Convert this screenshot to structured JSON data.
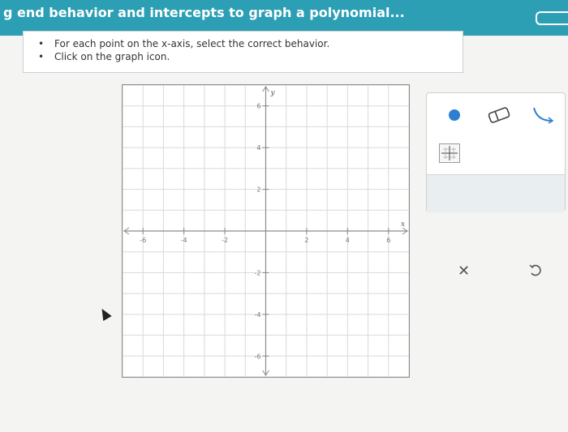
{
  "header": {
    "title": "g end behavior and intercepts to graph a polynomial..."
  },
  "instructions": {
    "items": [
      "For each point on the x-axis, select the correct behavior.",
      "Click on the graph icon."
    ]
  },
  "graph": {
    "x_axis_label": "x",
    "y_axis_label": "y",
    "x_min": -7,
    "x_max": 7,
    "y_min": -7,
    "y_max": 7,
    "x_tick_labels": [
      "-6",
      "-4",
      "-2",
      "2",
      "4",
      "6"
    ],
    "y_tick_labels": [
      "6",
      "4",
      "2",
      "-2",
      "-4",
      "-6"
    ],
    "grid_color": "#d9d9d9",
    "axis_color": "#8a8a8a"
  },
  "toolbox": {
    "tools": [
      {
        "name": "point-tool",
        "icon": "filled-dot-icon"
      },
      {
        "name": "eraser-tool",
        "icon": "eraser-icon"
      },
      {
        "name": "behavior-curve-tool",
        "icon": "curve-icon"
      },
      {
        "name": "graph-tool",
        "icon": "graph-icon"
      }
    ],
    "clear_glyph": "✕",
    "undo_icon": "undo-icon",
    "accent_color": "#2d7fd1"
  }
}
